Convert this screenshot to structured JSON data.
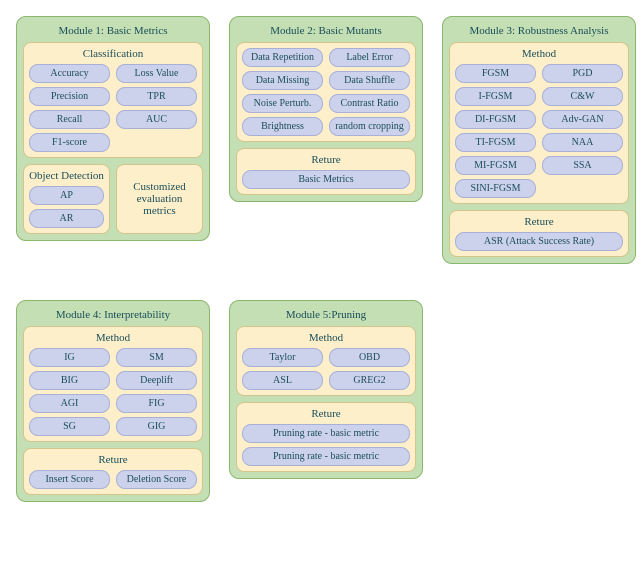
{
  "modules": {
    "m1": {
      "title": "Module 1: Basic Metrics",
      "classification": {
        "title": "Classification",
        "items": [
          "Accuracy",
          "Loss Value",
          "Precision",
          "TPR",
          "Recall",
          "AUC",
          "F1-score"
        ]
      },
      "object_detection": {
        "title": "Object Detection",
        "items": [
          "AP",
          "AR"
        ]
      },
      "customized": "Customized evaluation metrics"
    },
    "m2": {
      "title": "Module 2: Basic Mutants",
      "items": [
        "Data Repetition",
        "Label Error",
        "Data Missing",
        "Data Shuffle",
        "Noise Perturb.",
        "Contrast Ratio",
        "Brightness",
        "random cropping"
      ],
      "reture": {
        "title": "Reture",
        "items": [
          "Basic Metrics"
        ]
      }
    },
    "m3": {
      "title": "Module 3: Robustness Analysis",
      "method": {
        "title": "Method",
        "items": [
          "FGSM",
          "PGD",
          "I-FGSM",
          "C&W",
          "DI-FGSM",
          "Adv-GAN",
          "TI-FGSM",
          "NAA",
          "MI-FGSM",
          "SSA",
          "SINI-FGSM"
        ]
      },
      "reture": {
        "title": "Reture",
        "items": [
          "ASR (Attack Success Rate)"
        ]
      }
    },
    "m4": {
      "title": "Module 4: Interpretability",
      "method": {
        "title": "Method",
        "items": [
          "IG",
          "SM",
          "BIG",
          "Deeplift",
          "AGI",
          "FIG",
          "SG",
          "GIG"
        ]
      },
      "reture": {
        "title": "Reture",
        "items": [
          "Insert Score",
          "Deletion Score"
        ]
      }
    },
    "m5": {
      "title": "Module 5:Pruning",
      "method": {
        "title": "Method",
        "items": [
          "Taylor",
          "OBD",
          "ASL",
          "GREG2"
        ]
      },
      "reture": {
        "title": "Reture",
        "items": [
          "Pruning rate - basic metric",
          "Pruning rate - basic metric"
        ]
      }
    }
  }
}
